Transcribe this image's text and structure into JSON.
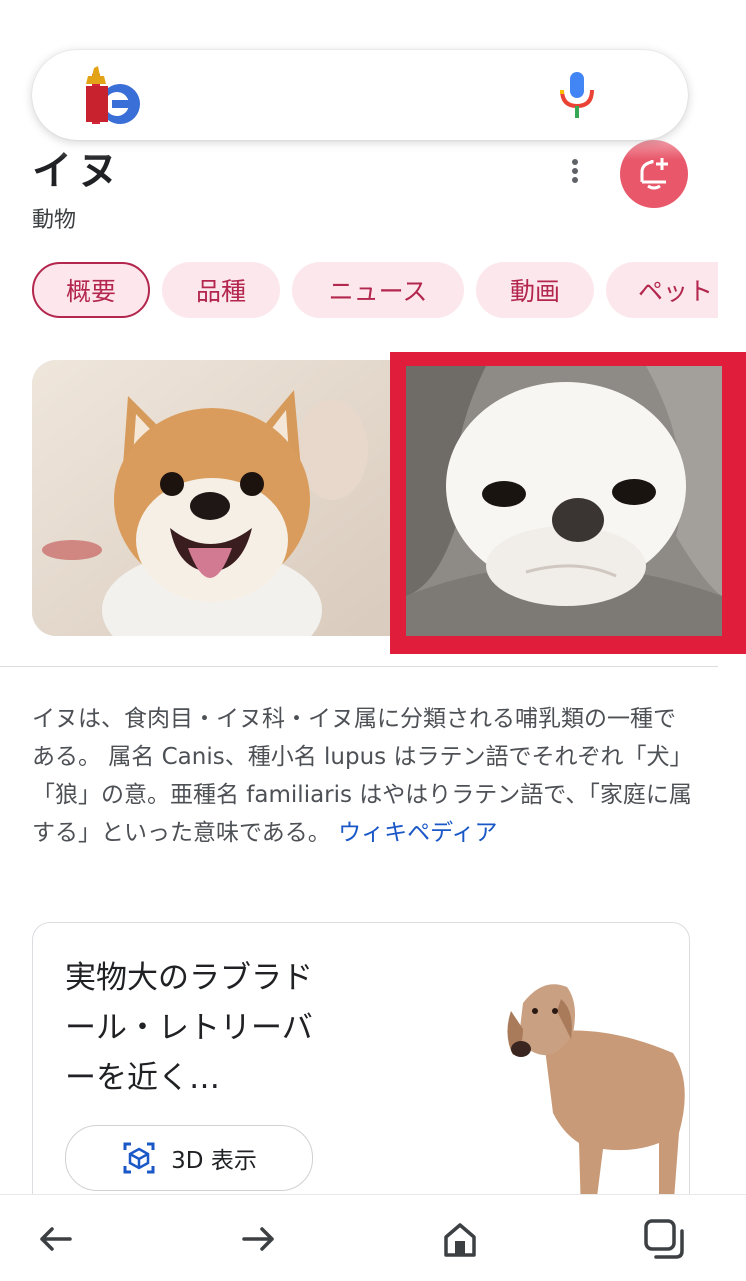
{
  "search": {
    "placeholder": "",
    "logo_icon": "google-logo-doodle-icon",
    "mic_icon": "mic-icon"
  },
  "entity": {
    "title": "イヌ",
    "subtitle": "動物",
    "more_icon": "more-vert-icon",
    "bell_icon": "add-notification-icon"
  },
  "chips": [
    {
      "label": "概要",
      "active": true
    },
    {
      "label": "品種",
      "active": false
    },
    {
      "label": "ニュース",
      "active": false
    },
    {
      "label": "動画",
      "active": false
    },
    {
      "label": "ペット",
      "active": false
    }
  ],
  "images": [
    {
      "name": "shiba-inu-image",
      "selected": false
    },
    {
      "name": "chihuahua-image",
      "selected": true
    }
  ],
  "description": {
    "text": "イヌは、食肉目・イヌ科・イヌ属に分類される哺乳類の一種である。 属名 Canis、種小名 lupus はラテン語でそれぞれ「犬」「狼」の意。亜種名 familiaris はやはりラテン語で、「家庭に属する」といった意味である。 ",
    "source_link": "ウィキペディア"
  },
  "card3d": {
    "title": "実物大のラブラドール・レトリーバーを近く…",
    "button_label": "3D 表示",
    "button_icon": "3d-cube-icon"
  },
  "bottom_nav": {
    "back_icon": "arrow-left-icon",
    "forward_icon": "arrow-right-icon",
    "home_icon": "home-icon",
    "tabs_icon": "tabs-icon"
  },
  "colors": {
    "chip_bg": "#fce8ec",
    "chip_text": "#b3264d",
    "link": "#1a57c7",
    "highlight": "#e11d3c",
    "bell_bg": "#e8576a"
  }
}
